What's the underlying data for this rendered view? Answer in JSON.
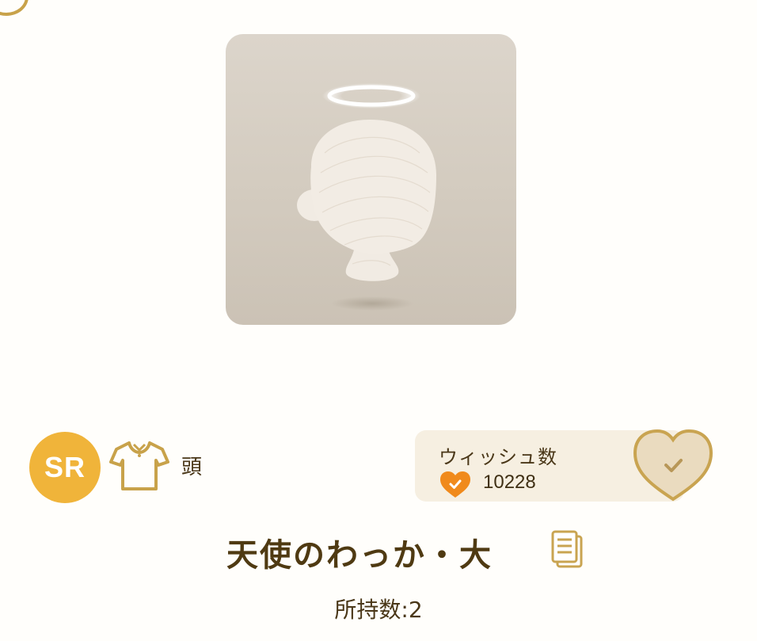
{
  "item": {
    "rarity": "SR",
    "category": "頭",
    "name": "天使のわっか・大",
    "owned_label": "所持数",
    "owned_separator": " : ",
    "owned_count": "2"
  },
  "wish": {
    "label": "ウィッシュ数",
    "count": "10228",
    "wished": true
  },
  "icons": {
    "rarity_badge": "sr-badge",
    "category": "shirt-icon",
    "wish_count": "heart-check-icon",
    "wish_button": "heart-check-button-icon",
    "copy": "copy-icon",
    "preview_subject": "mannequin-head-with-halo"
  },
  "colors": {
    "accent_gold": "#f0b43a",
    "heart_orange": "#f08a1c",
    "text_brown": "#4f3a12",
    "wish_box_bg": "#f6efe1",
    "preview_bg": "#d6cfc4"
  }
}
